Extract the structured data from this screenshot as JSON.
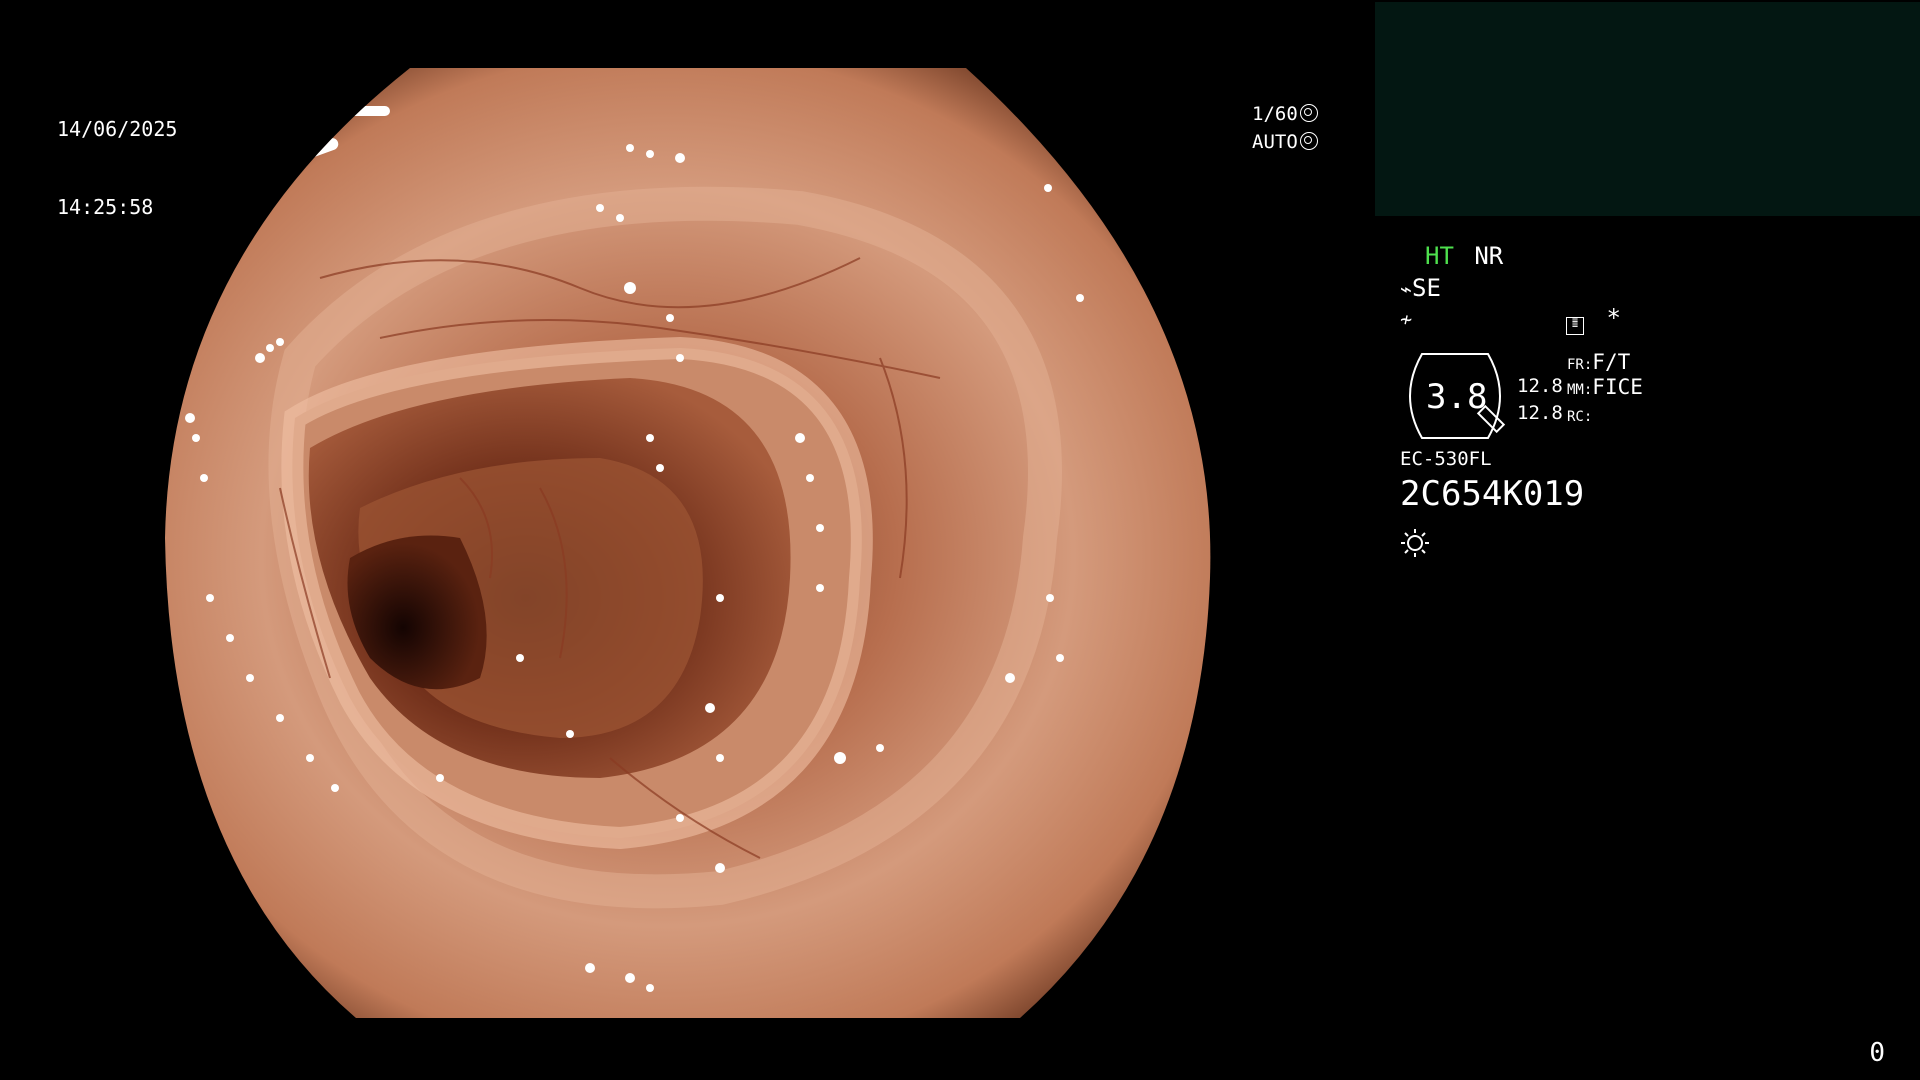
{
  "overlay": {
    "date": "14/06/2025",
    "time": "14:25:58",
    "shutter_speed": "1/60",
    "exposure_mode": "AUTO"
  },
  "panel": {
    "ht_label": "HT",
    "nr_label": "NR",
    "se_label": "SE",
    "gauge_value": "3.8",
    "left_value_1": "12.8",
    "left_value_2": "12.8",
    "fr_label": "FR:",
    "fr_value": "F/T",
    "mm_label": "MM:",
    "mm_value": "FICE",
    "rc_label": "RC:",
    "scope_model": "EC-530FL",
    "scope_serial": "2C654K019",
    "asterisk": "*"
  },
  "corner_count": "0",
  "colors": {
    "background": "#000000",
    "thumbnail_bg": "#031712",
    "ht_green": "#4ee04e",
    "mucosa": "#c98a6a"
  },
  "icons": [
    "shutter-icon",
    "iris-icon",
    "enhance-icon",
    "contrast-icon",
    "menu-icon",
    "light-icon"
  ]
}
